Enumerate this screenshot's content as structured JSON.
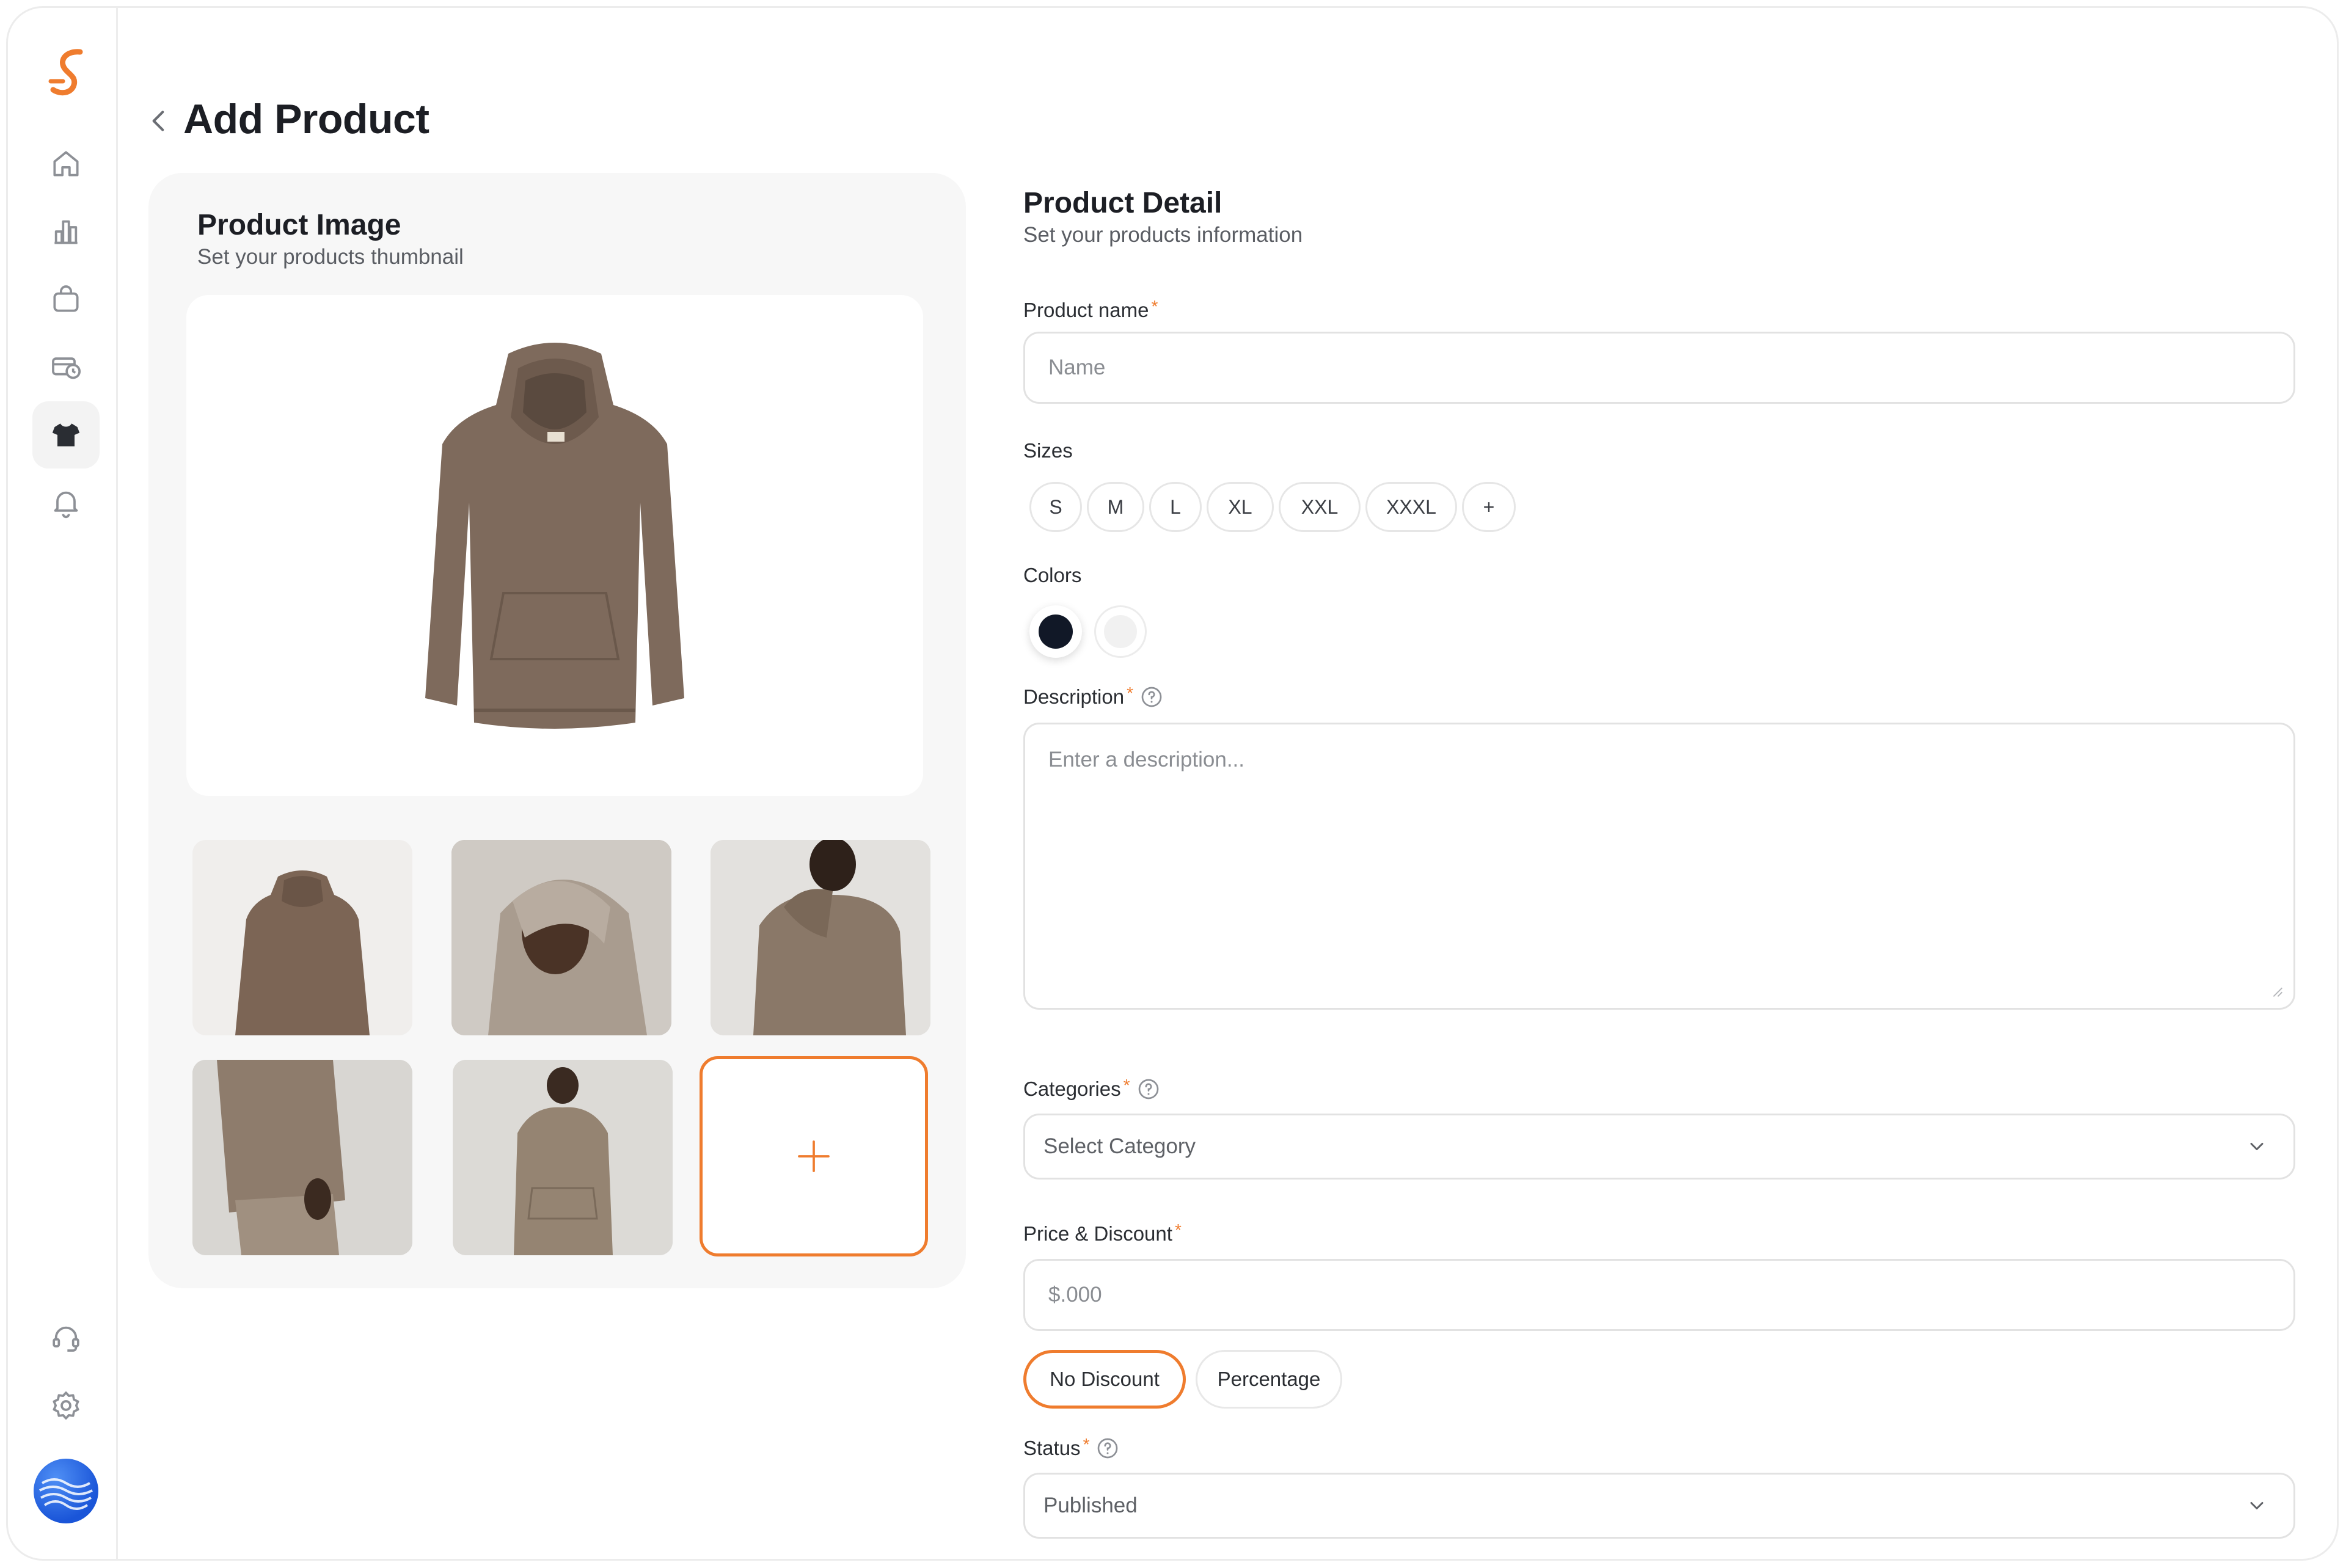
{
  "page": {
    "title": "Add Product"
  },
  "image_panel": {
    "title": "Product Image",
    "subtitle": "Set your products thumbnail",
    "add_label": "+"
  },
  "detail": {
    "title": "Product Detail",
    "subtitle": "Set your products information",
    "product_name": {
      "label": "Product name",
      "required": "*",
      "placeholder": "Name",
      "value": ""
    },
    "sizes": {
      "label": "Sizes",
      "options": [
        "S",
        "M",
        "L",
        "XL",
        "XXL",
        "XXXL",
        "+"
      ]
    },
    "colors": {
      "label": "Colors",
      "swatches": [
        "#111827",
        "#f1f1f1"
      ]
    },
    "description": {
      "label": "Description",
      "required": "*",
      "placeholder": "Enter a description..."
    },
    "categories": {
      "label": "Categories",
      "required": "*",
      "value": "Select Category"
    },
    "price": {
      "label": "Price & Discount",
      "required": "*",
      "placeholder": "$.000"
    },
    "discount_options": [
      "No Discount",
      "Percentage"
    ],
    "status": {
      "label": "Status",
      "required": "*",
      "value": "Published"
    }
  },
  "colors": {
    "accent": "#ef7c2e",
    "text": "#1c1e24",
    "muted": "#5a5d63",
    "border": "#e2e2e2"
  },
  "sidebar": {
    "items": [
      "home-icon",
      "chart-icon",
      "bag-icon",
      "payment-icon",
      "tshirt-icon",
      "bell-icon"
    ],
    "bottom": [
      "headset-icon",
      "gear-icon"
    ]
  }
}
